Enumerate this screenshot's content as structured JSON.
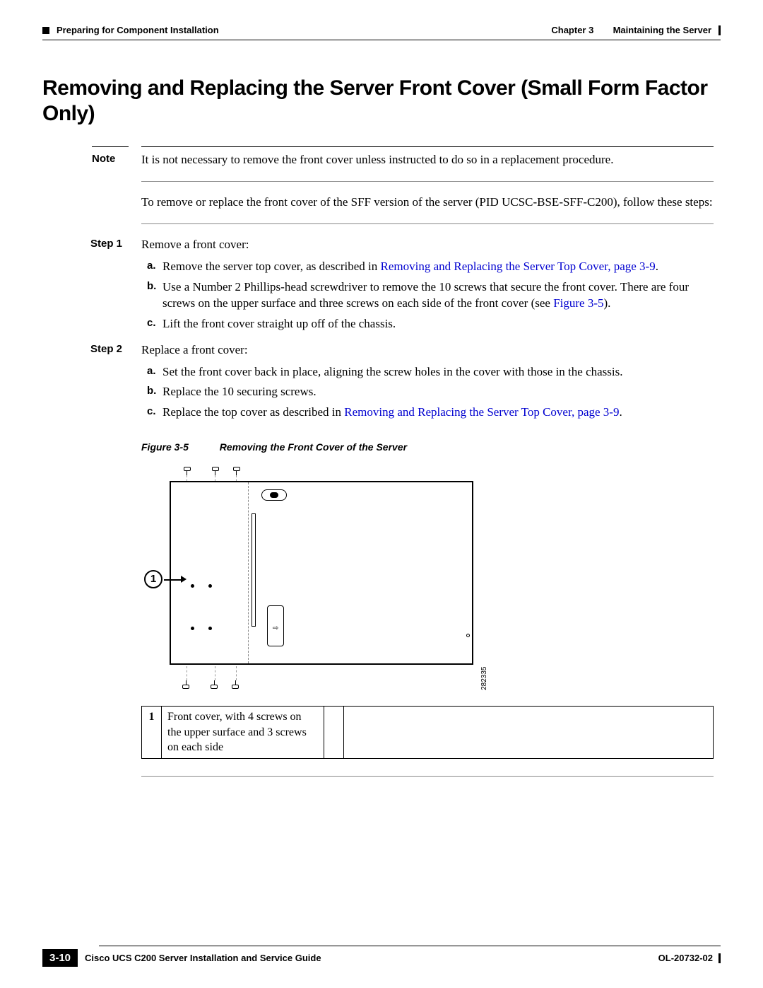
{
  "header": {
    "chapter": "Chapter 3",
    "chapter_title": "Maintaining the Server",
    "section": "Preparing for Component Installation"
  },
  "title": "Removing and Replacing the Server Front Cover (Small Form Factor Only)",
  "note": {
    "label": "Note",
    "text": "It is not necessary to remove the front cover unless instructed to do so in a replacement procedure."
  },
  "intro": "To remove or replace the front cover of the SFF version of the server (PID UCSC-BSE-SFF-C200), follow these steps:",
  "steps": [
    {
      "label": "Step 1",
      "text": "Remove a front cover:",
      "subs": [
        {
          "m": "a.",
          "pre": "Remove the server top cover, as described in ",
          "link": "Removing and Replacing the Server Top Cover, page 3-9",
          "post": "."
        },
        {
          "m": "b.",
          "pre": "Use a Number 2 Phillips-head screwdriver to remove the 10 screws that secure the front cover. There are four screws on the upper surface and three screws on each side of the front cover (see ",
          "link": "Figure 3-5",
          "post": ")."
        },
        {
          "m": "c.",
          "pre": "Lift the front cover straight up off of the chassis.",
          "link": "",
          "post": ""
        }
      ]
    },
    {
      "label": "Step 2",
      "text": "Replace a front cover:",
      "subs": [
        {
          "m": "a.",
          "pre": "Set the front cover back in place, aligning the screw holes in the cover with those in the chassis.",
          "link": "",
          "post": ""
        },
        {
          "m": "b.",
          "pre": "Replace the 10 securing screws.",
          "link": "",
          "post": ""
        },
        {
          "m": "c.",
          "pre": "Replace the top cover as described in ",
          "link": "Removing and Replacing the Server Top Cover, page 3-9",
          "post": "."
        }
      ]
    }
  ],
  "figure": {
    "num": "Figure 3-5",
    "caption": "Removing the Front Cover of the Server",
    "callout": "1",
    "img_id": "282335"
  },
  "legend": {
    "num": "1",
    "desc": "Front cover, with 4 screws on the upper surface and 3 screws on each side"
  },
  "footer": {
    "guide": "Cisco UCS C200 Server Installation and Service Guide",
    "page": "3-10",
    "doc": "OL-20732-02"
  }
}
